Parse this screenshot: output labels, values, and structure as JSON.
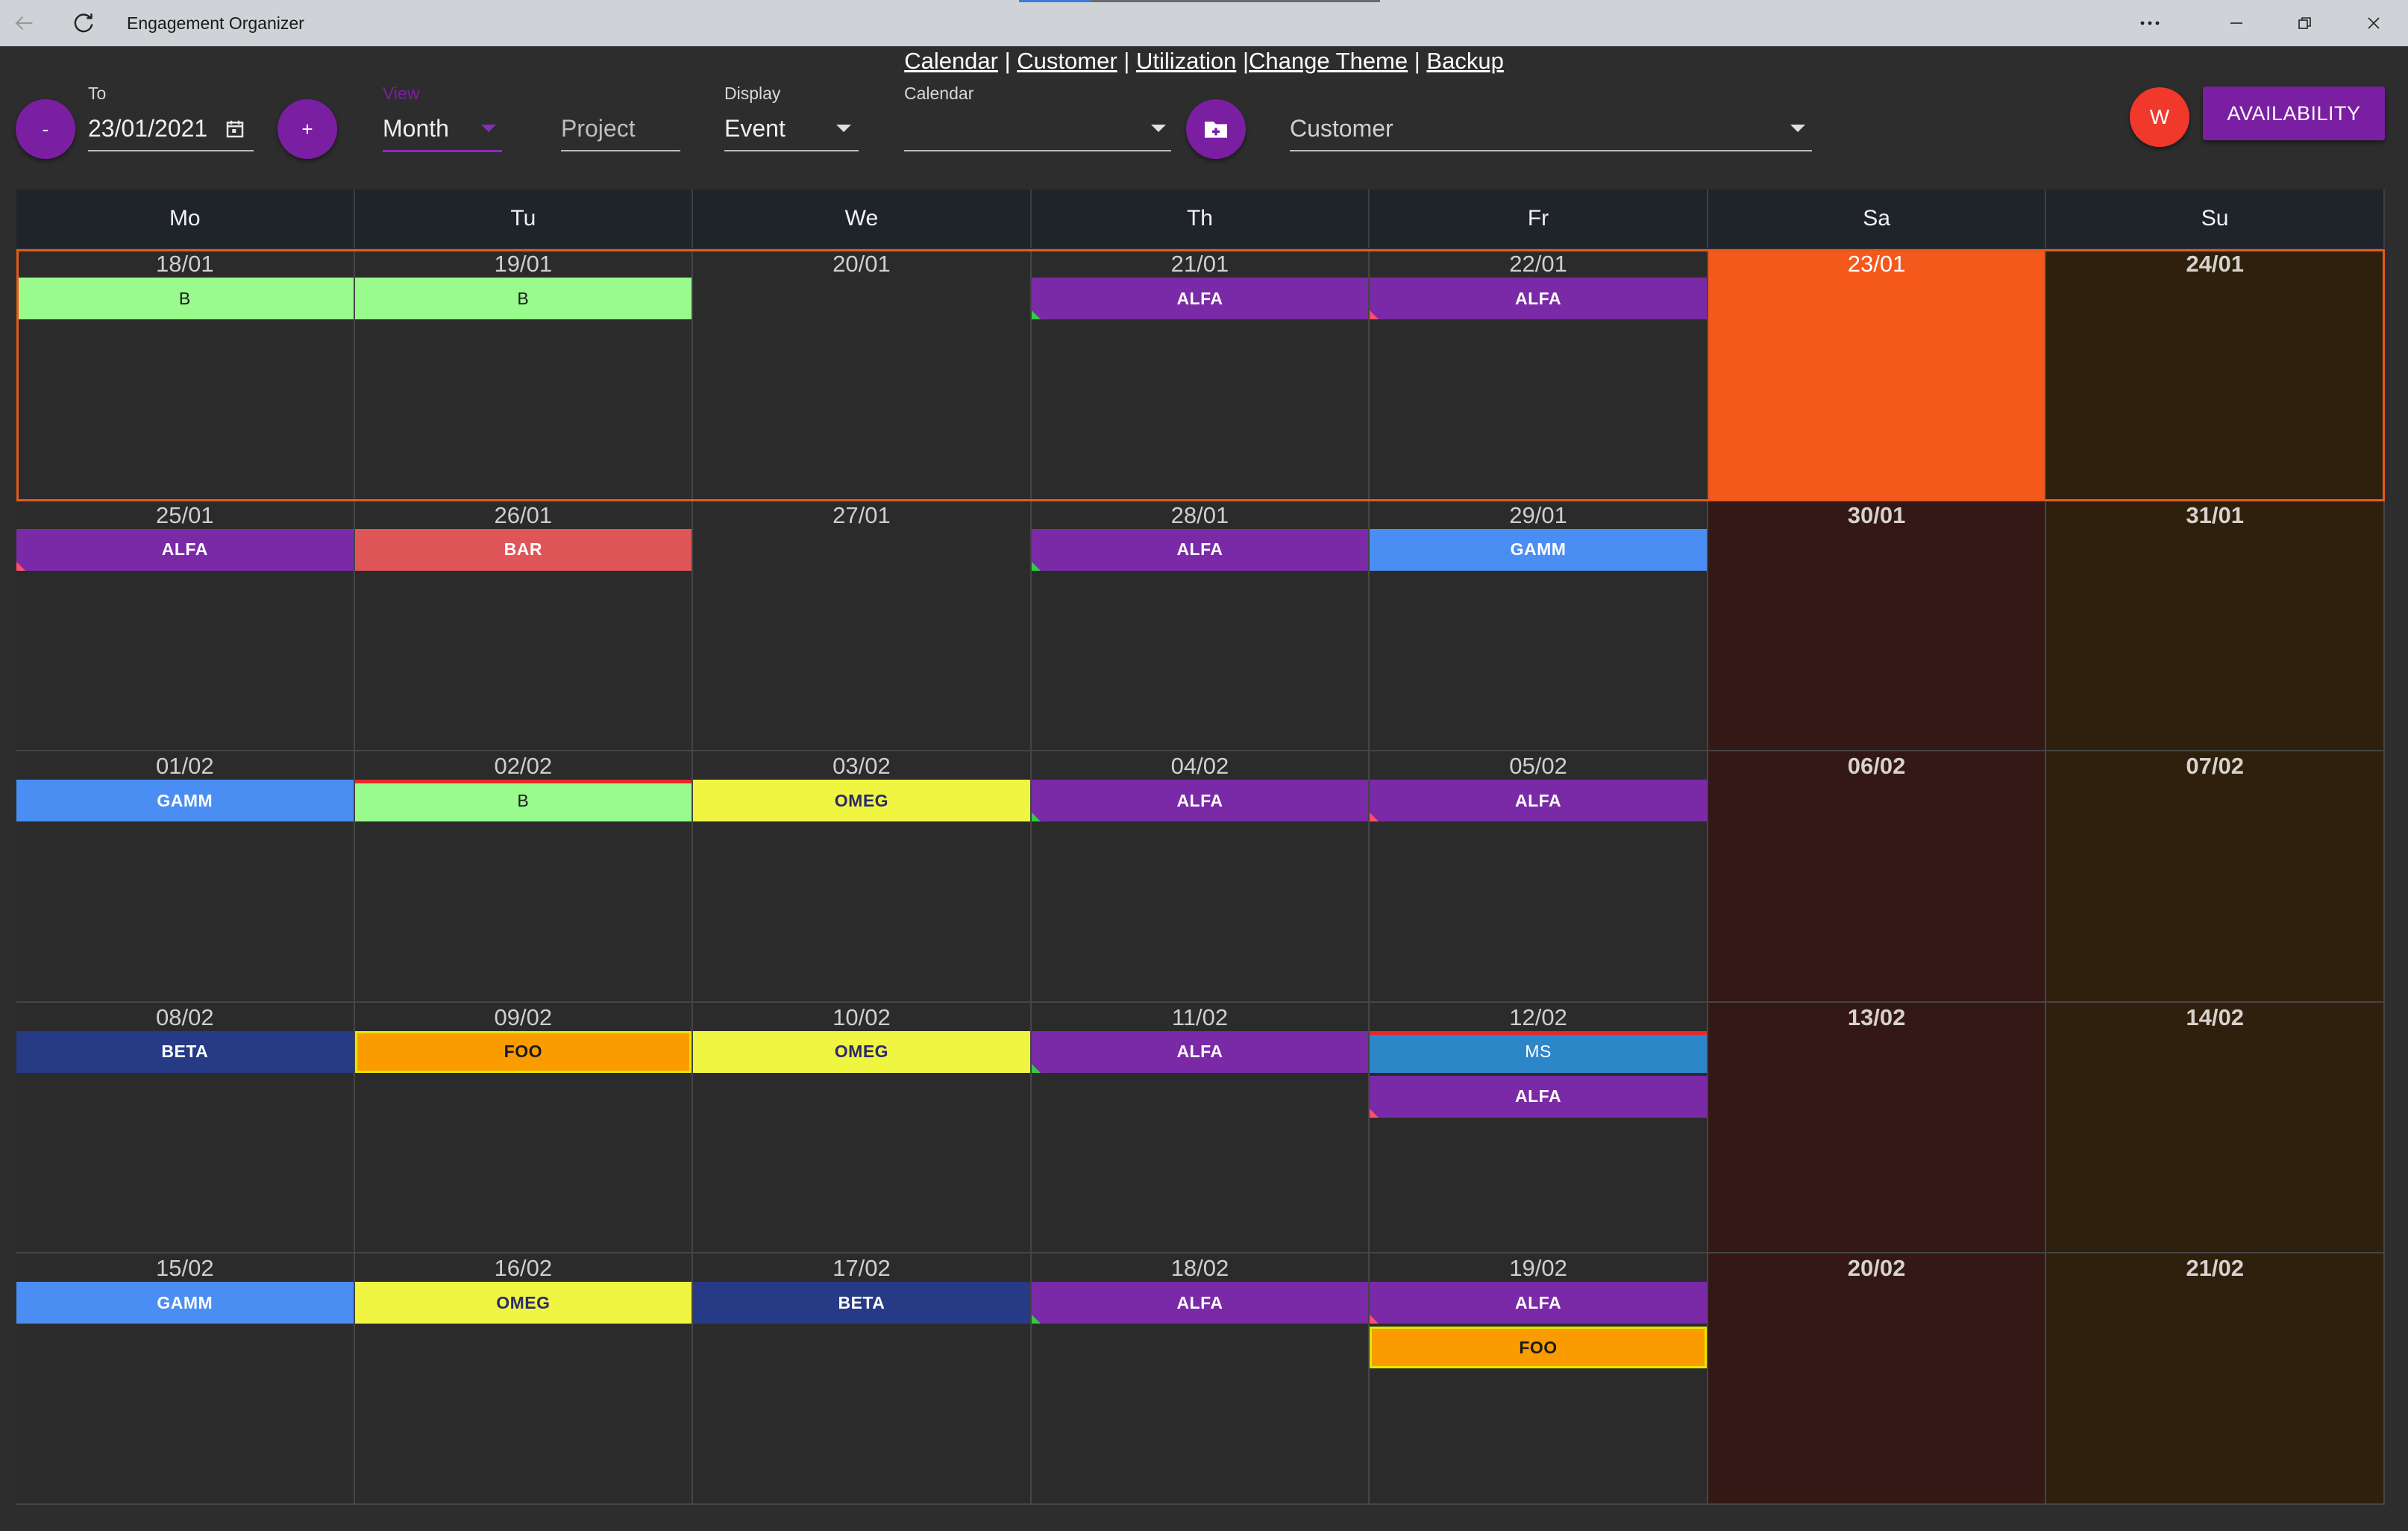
{
  "window": {
    "title": "Engagement Organizer"
  },
  "nav": {
    "links": [
      "Calendar",
      "Customer",
      "Utilization",
      "Change Theme",
      "Backup"
    ],
    "separators": [
      " | ",
      " | ",
      " |",
      " | "
    ]
  },
  "toolbar": {
    "prev_label": "-",
    "next_label": "+",
    "to_label": "To",
    "date_value": "23/01/2021",
    "view_label": "View",
    "view_value": "Month",
    "project_placeholder": "Project",
    "display_label": "Display",
    "display_value": "Event",
    "calendar_label": "Calendar",
    "calendar_value": "",
    "customer_placeholder": "Customer",
    "avatar_initial": "W",
    "availability_label": "AVAILABILITY"
  },
  "colors": {
    "accent_purple": "#7a1fa2",
    "today": "#f5581b",
    "avatar": "#f0382b"
  },
  "calendar": {
    "weekday_headers": [
      "Mo",
      "Tu",
      "We",
      "Th",
      "Fr",
      "Sa",
      "Su"
    ],
    "days": [
      {
        "date": "18/01",
        "events": [
          {
            "label": "B",
            "style": "b"
          }
        ]
      },
      {
        "date": "19/01",
        "events": [
          {
            "label": "B",
            "style": "b"
          }
        ]
      },
      {
        "date": "20/01",
        "events": []
      },
      {
        "date": "21/01",
        "events": [
          {
            "label": "ALFA",
            "style": "alfa",
            "corner": "#2ecc40"
          }
        ]
      },
      {
        "date": "22/01",
        "events": [
          {
            "label": "ALFA",
            "style": "alfa",
            "corner": "#ff4f6b"
          }
        ]
      },
      {
        "date": "23/01",
        "today": true,
        "events": []
      },
      {
        "date": "24/01",
        "events": []
      },
      {
        "date": "25/01",
        "events": [
          {
            "label": "ALFA",
            "style": "alfa",
            "corner": "#ff4f6b"
          }
        ]
      },
      {
        "date": "26/01",
        "events": [
          {
            "label": "BAR",
            "style": "bar"
          }
        ]
      },
      {
        "date": "27/01",
        "events": []
      },
      {
        "date": "28/01",
        "events": [
          {
            "label": "ALFA",
            "style": "alfa",
            "corner": "#2ecc40"
          }
        ]
      },
      {
        "date": "29/01",
        "events": [
          {
            "label": "GAMM",
            "style": "gamm"
          }
        ]
      },
      {
        "date": "30/01",
        "events": []
      },
      {
        "date": "31/01",
        "events": []
      },
      {
        "date": "01/02",
        "events": [
          {
            "label": "GAMM",
            "style": "gamm"
          }
        ]
      },
      {
        "date": "02/02",
        "events": [
          {
            "label": "B",
            "style": "b",
            "redtop": true
          }
        ]
      },
      {
        "date": "03/02",
        "events": [
          {
            "label": "OMEG",
            "style": "omeg"
          }
        ]
      },
      {
        "date": "04/02",
        "events": [
          {
            "label": "ALFA",
            "style": "alfa",
            "corner": "#2ecc40"
          }
        ]
      },
      {
        "date": "05/02",
        "events": [
          {
            "label": "ALFA",
            "style": "alfa",
            "corner": "#ff4f6b"
          }
        ]
      },
      {
        "date": "06/02",
        "events": []
      },
      {
        "date": "07/02",
        "events": []
      },
      {
        "date": "08/02",
        "events": [
          {
            "label": "BETA",
            "style": "beta"
          }
        ]
      },
      {
        "date": "09/02",
        "events": [
          {
            "label": "FOO",
            "style": "foo"
          }
        ]
      },
      {
        "date": "10/02",
        "events": [
          {
            "label": "OMEG",
            "style": "omeg"
          }
        ]
      },
      {
        "date": "11/02",
        "events": [
          {
            "label": "ALFA",
            "style": "alfa",
            "corner": "#2ecc40"
          }
        ]
      },
      {
        "date": "12/02",
        "events": [
          {
            "label": "MS",
            "style": "ms",
            "redtop": true
          },
          {
            "label": "ALFA",
            "style": "alfa",
            "corner": "#ff4f6b"
          }
        ]
      },
      {
        "date": "13/02",
        "events": []
      },
      {
        "date": "14/02",
        "events": []
      },
      {
        "date": "15/02",
        "events": [
          {
            "label": "GAMM",
            "style": "gamm"
          }
        ]
      },
      {
        "date": "16/02",
        "events": [
          {
            "label": "OMEG",
            "style": "omeg"
          }
        ]
      },
      {
        "date": "17/02",
        "events": [
          {
            "label": "BETA",
            "style": "beta"
          }
        ]
      },
      {
        "date": "18/02",
        "events": [
          {
            "label": "ALFA",
            "style": "alfa",
            "corner": "#2ecc40"
          }
        ]
      },
      {
        "date": "19/02",
        "events": [
          {
            "label": "ALFA",
            "style": "alfa",
            "corner": "#ff4f6b"
          },
          {
            "label": "FOO",
            "style": "foo"
          }
        ]
      },
      {
        "date": "20/02",
        "events": []
      },
      {
        "date": "21/02",
        "events": []
      }
    ],
    "event_styles": {
      "b": {
        "bg": "#98fb8c",
        "fg": "#1b1b1b",
        "weight": "normal"
      },
      "alfa": {
        "bg": "#7a2aa6",
        "fg": "#ffffff"
      },
      "bar": {
        "bg": "#e05557",
        "fg": "#ffffff"
      },
      "gamm": {
        "bg": "#4b8ef3",
        "fg": "#ffffff"
      },
      "omeg": {
        "bg": "#f0f542",
        "fg": "#2b2b6b"
      },
      "beta": {
        "bg": "#263a86",
        "fg": "#ffffff"
      },
      "foo": {
        "bg": "#fa9c00",
        "fg": "#1b1b1b",
        "border": "#e6e600"
      },
      "ms": {
        "bg": "#2d86c8",
        "fg": "#ffffff",
        "weight": "normal"
      }
    }
  }
}
